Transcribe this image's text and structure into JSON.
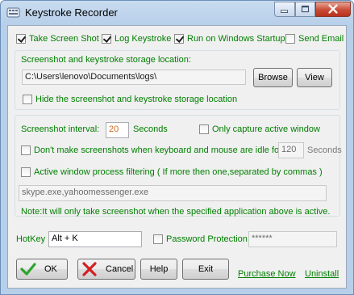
{
  "window": {
    "title": "Keystroke Recorder"
  },
  "options": {
    "take_screenshot": {
      "label": "Take Screen Shot",
      "checked": true
    },
    "log_keystroke": {
      "label": "Log Keystroke",
      "checked": true
    },
    "run_on_startup": {
      "label": "Run on Windows Startup",
      "checked": true
    },
    "send_email": {
      "label": "Send Email",
      "checked": false
    }
  },
  "storage": {
    "label": "Screenshot and keystroke storage location:",
    "path": "C:\\Users\\lenovo\\Documents\\logs\\",
    "browse_label": "Browse",
    "view_label": "View",
    "hide_label": "Hide the screenshot and keystroke storage location"
  },
  "screenshot": {
    "interval_label": "Screenshot interval:",
    "interval_value": "20",
    "seconds_label": "Seconds",
    "active_window_label": "Only capture active window",
    "idle_label": "Don't make screenshots when keyboard and mouse are idle for",
    "idle_value": "120",
    "idle_seconds_label": "Seconds",
    "filter_label": "Active window process filtering ( If  more then one,separated by commas )",
    "filter_value": "skype.exe,yahoomessenger.exe",
    "note": "Note:It will only take screenshot when the specified application above is active."
  },
  "hotkey": {
    "label": "HotKey",
    "value": "Alt + K"
  },
  "password": {
    "label": "Password Protection",
    "value": "******"
  },
  "buttons": {
    "ok": "OK",
    "cancel": "Cancel",
    "help": "Help",
    "exit": "Exit"
  },
  "links": {
    "purchase": "Purchase Now",
    "uninstall": "Uninstall"
  },
  "icons": {
    "app": "keyboard-icon",
    "ok": "checkmark-icon",
    "cancel": "red-x-icon",
    "minimize": "minimize-icon",
    "maximize": "maximize-icon",
    "close": "close-icon"
  },
  "colors": {
    "accent_green": "#007f00",
    "close_red": "#c94b34"
  }
}
